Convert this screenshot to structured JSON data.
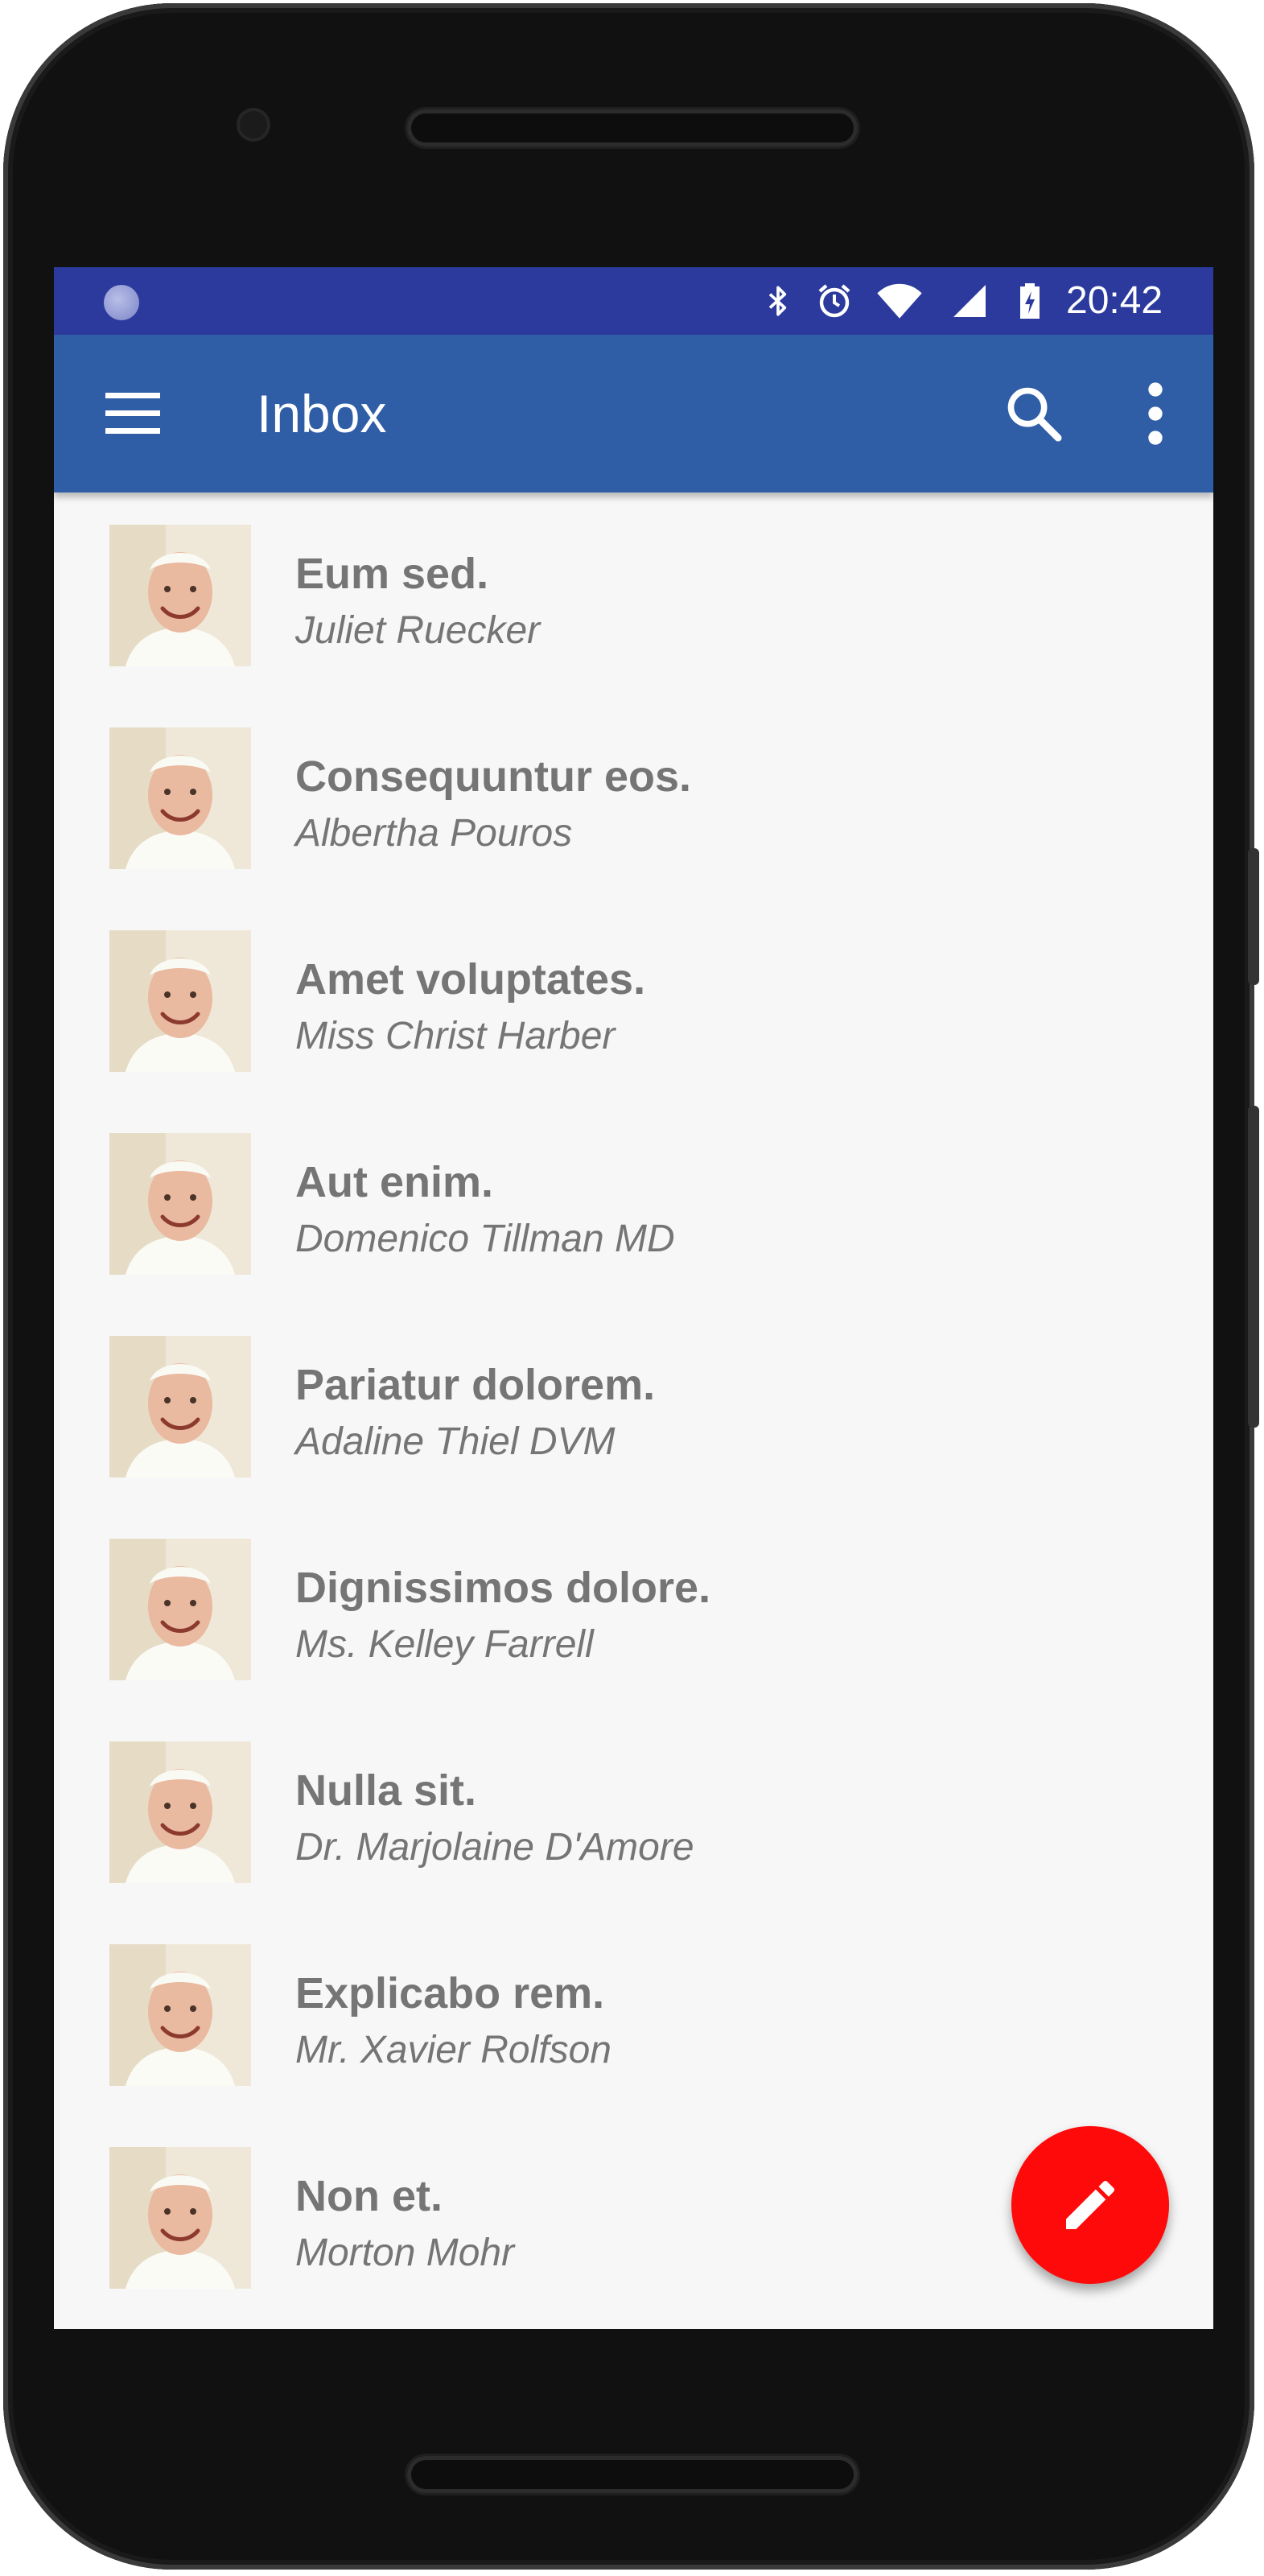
{
  "status_bar": {
    "time": "20:42",
    "icons": [
      "notification-icon",
      "bluetooth-icon",
      "alarm-icon",
      "wifi-icon",
      "signal-icon",
      "battery-charging-icon"
    ]
  },
  "app_bar": {
    "title": "Inbox",
    "icons": [
      "menu-icon",
      "search-icon",
      "more-vert-icon"
    ]
  },
  "messages": [
    {
      "subject": "Eum sed.",
      "sender": "Juliet Ruecker"
    },
    {
      "subject": "Consequuntur eos.",
      "sender": "Albertha Pouros"
    },
    {
      "subject": "Amet voluptates.",
      "sender": "Miss Christ Harber"
    },
    {
      "subject": "Aut enim.",
      "sender": "Domenico Tillman MD"
    },
    {
      "subject": "Pariatur dolorem.",
      "sender": "Adaline Thiel DVM"
    },
    {
      "subject": "Dignissimos dolore.",
      "sender": "Ms. Kelley Farrell"
    },
    {
      "subject": "Nulla sit.",
      "sender": "Dr. Marjolaine D'Amore"
    },
    {
      "subject": "Explicabo rem.",
      "sender": "Mr. Xavier Rolfson"
    },
    {
      "subject": "Non et.",
      "sender": "Morton Mohr"
    }
  ],
  "fab": {
    "icon": "edit-pencil-icon"
  },
  "colors": {
    "status_bar": "#2b3a9c",
    "app_bar": "#2f5ea6",
    "list_background": "#f7f7f7",
    "text": "#757575",
    "fab": "#ff0a0a"
  }
}
